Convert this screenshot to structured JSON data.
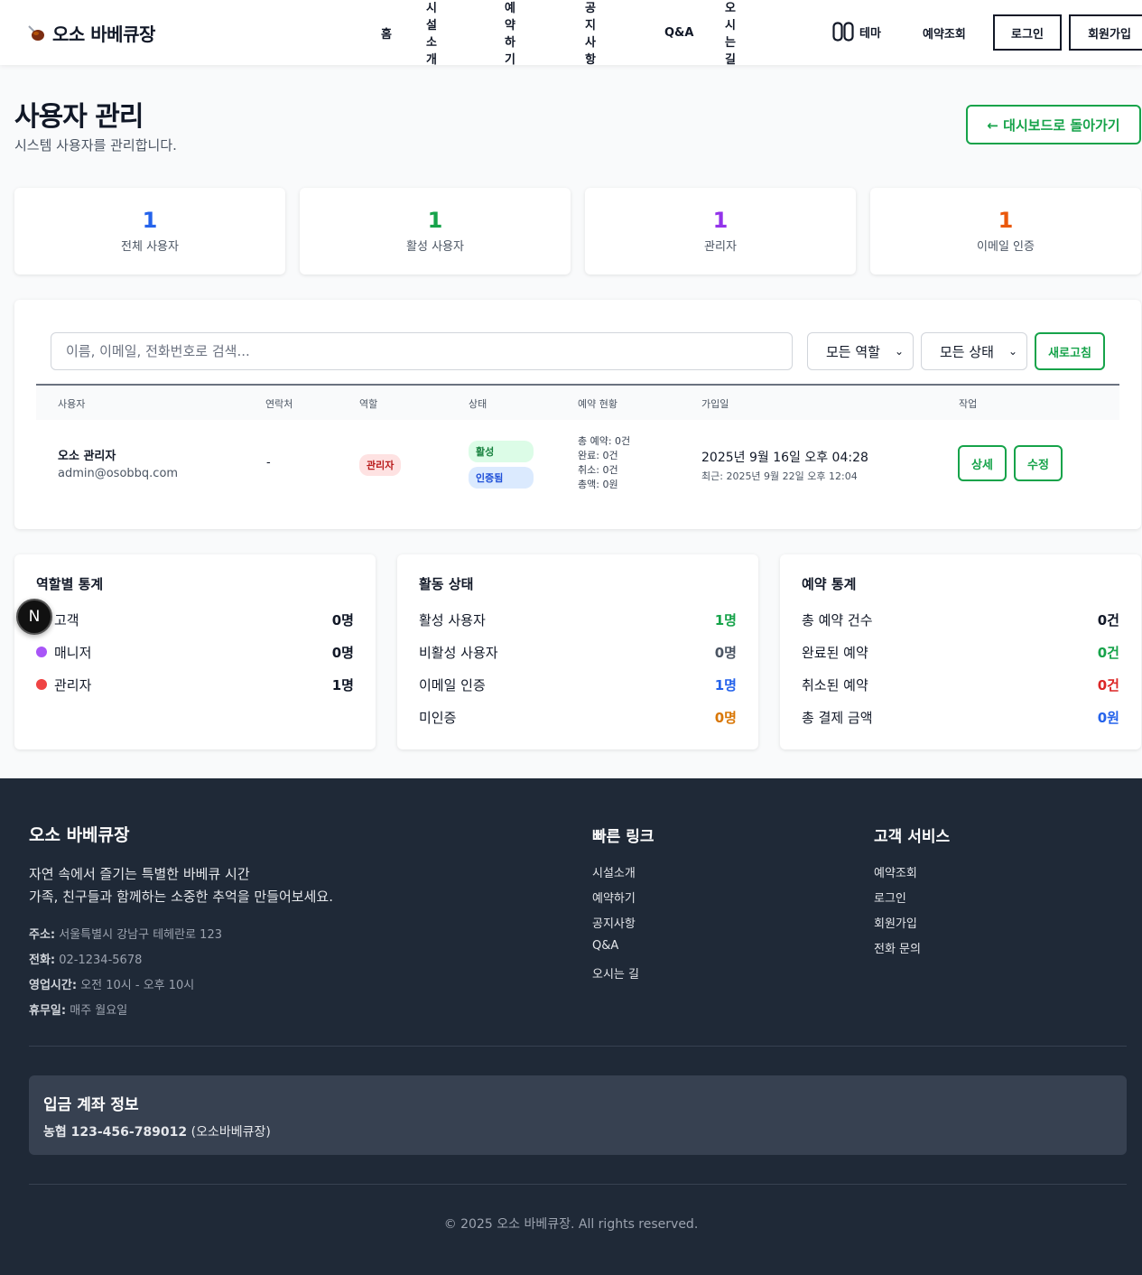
{
  "header": {
    "brand": "오소 바베큐장",
    "nav": [
      "홈",
      "시설소개",
      "예약하기",
      "공지사항",
      "Q&A",
      "오시는 길"
    ],
    "theme": "테마",
    "lookup": "예약조회",
    "login": "로그인",
    "signup": "회원가입"
  },
  "page": {
    "title": "사용자 관리",
    "subtitle": "시스템 사용자를 관리합니다.",
    "back_button": "← 대시보드로 돌아가기"
  },
  "stats": [
    {
      "value": "1",
      "label": "전체 사용자",
      "color": "#2563eb"
    },
    {
      "value": "1",
      "label": "활성 사용자",
      "color": "#16a34a"
    },
    {
      "value": "1",
      "label": "관리자",
      "color": "#9333ea"
    },
    {
      "value": "1",
      "label": "이메일 인증",
      "color": "#ea580c"
    }
  ],
  "filters": {
    "search_placeholder": "이름, 이메일, 전화번호로 검색...",
    "role_select": "모든 역할",
    "status_select": "모든 상태",
    "refresh": "새로고침"
  },
  "table": {
    "headers": [
      "사용자",
      "연락처",
      "역할",
      "상태",
      "예약 현황",
      "가입일",
      "작업"
    ],
    "rows": [
      {
        "name": "오소 관리자",
        "email": "admin@osobbq.com",
        "contact": "-",
        "role": "관리자",
        "status": [
          "활성",
          "인증됨"
        ],
        "reservations": [
          "총 예약: 0건",
          "완료: 0건",
          "취소: 0건",
          "총액: 0원"
        ],
        "joined": "2025년 9월 16일 오후 04:28",
        "recent": "최근: 2025년 9월 22일 오후 12:04",
        "actions": [
          "상세",
          "수정"
        ]
      }
    ]
  },
  "role_stats": {
    "title": "역할별 통계",
    "items": [
      {
        "label": "고객",
        "value": "0명",
        "color": "#3b82f6"
      },
      {
        "label": "매니저",
        "value": "0명",
        "color": "#a855f7"
      },
      {
        "label": "관리자",
        "value": "1명",
        "color": "#ef4444"
      }
    ]
  },
  "activity_stats": {
    "title": "활동 상태",
    "items": [
      {
        "label": "활성 사용자",
        "value": "1명",
        "color": "#16a34a"
      },
      {
        "label": "비활성 사용자",
        "value": "0명",
        "color": "#4b5563"
      },
      {
        "label": "이메일 인증",
        "value": "1명",
        "color": "#2563eb"
      },
      {
        "label": "미인증",
        "value": "0명",
        "color": "#d97706"
      }
    ]
  },
  "reservation_stats": {
    "title": "예약 통계",
    "items": [
      {
        "label": "총 예약 건수",
        "value": "0건",
        "color": "#111827"
      },
      {
        "label": "완료된 예약",
        "value": "0건",
        "color": "#16a34a"
      },
      {
        "label": "취소된 예약",
        "value": "0건",
        "color": "#dc2626"
      },
      {
        "label": "총 결제 금액",
        "value": "0원",
        "color": "#2563eb"
      }
    ]
  },
  "floating_badge": "N",
  "footer": {
    "brand": "오소 바베큐장",
    "desc1": "자연 속에서 즐기는 특별한 바베큐 시간",
    "desc2": "가족, 친구들과 함께하는 소중한 추억을 만들어보세요.",
    "info": [
      {
        "key": "주소:",
        "value": "서울특별시 강남구 테헤란로 123"
      },
      {
        "key": "전화:",
        "value": "02-1234-5678"
      },
      {
        "key": "영업시간:",
        "value": "오전 10시 - 오후 10시"
      },
      {
        "key": "휴무일:",
        "value": "매주 월요일"
      }
    ],
    "quick_title": "빠른 링크",
    "quick_links": [
      "시설소개",
      "예약하기",
      "공지사항",
      "Q&A",
      "오시는 길"
    ],
    "service_title": "고객 서비스",
    "service_links": [
      "예약조회",
      "로그인",
      "회원가입",
      "전화 문의"
    ],
    "account_title": "입금 계좌 정보",
    "account_number": "농협 123-456-789012",
    "account_holder": "(오소바베큐장)",
    "copyright": "© 2025 오소 바베큐장. All rights reserved."
  }
}
